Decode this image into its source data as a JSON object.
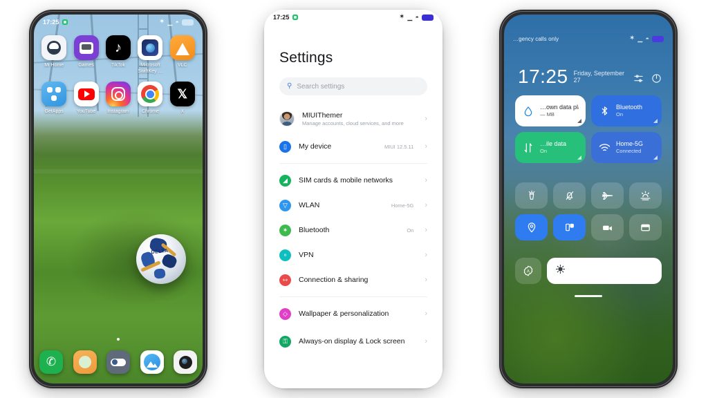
{
  "phone_home": {
    "status_bar": {
      "time": "17:25",
      "icons": [
        "green-shield-icon",
        "bluetooth-icon",
        "signal-icon",
        "wifi-icon",
        "battery-icon"
      ]
    },
    "apps": [
      {
        "label": "Mi Home",
        "icon": "mi-home-icon"
      },
      {
        "label": "Games",
        "icon": "games-icon"
      },
      {
        "label": "TikTok",
        "icon": "tiktok-icon",
        "glyph": "♪"
      },
      {
        "label": "Microsoft SwiftKey …",
        "icon": "microsoft-swiftkey-icon"
      },
      {
        "label": "VLC",
        "icon": "vlc-icon"
      },
      {
        "label": "GetApps",
        "icon": "getapps-icon"
      },
      {
        "label": "YouTube",
        "icon": "youtube-icon"
      },
      {
        "label": "Instagram",
        "icon": "instagram-icon"
      },
      {
        "label": "Chrome",
        "icon": "chrome-icon"
      },
      {
        "label": "X",
        "icon": "x-icon",
        "glyph": "𝕏"
      }
    ],
    "ball_brand": "DELTA",
    "dock": [
      {
        "name": "phone-app-icon",
        "glyph": "✆"
      },
      {
        "name": "messages-app-icon",
        "glyph": ""
      },
      {
        "name": "settings-app-icon",
        "glyph": ""
      },
      {
        "name": "gallery-app-icon",
        "glyph": ""
      },
      {
        "name": "camera-app-icon",
        "glyph": ""
      }
    ],
    "page_indicator_count": 1
  },
  "phone_settings": {
    "status_bar": {
      "time": "17:25"
    },
    "title": "Settings",
    "search": {
      "placeholder": "Search settings",
      "icon": "search-icon"
    },
    "account": {
      "name": "MIUIThemer",
      "subtitle": "Manage accounts, cloud services, and more",
      "avatar": "user-avatar"
    },
    "rows": [
      {
        "label": "My device",
        "value": "MIUI 12.5.11",
        "icon": "device-icon",
        "color": "bg-blue"
      },
      {
        "label": "SIM cards & mobile networks",
        "value": "",
        "icon": "sim-card-icon",
        "color": "bg-green"
      },
      {
        "label": "WLAN",
        "value": "Home-5G",
        "icon": "wlan-icon",
        "color": "bg-ltblue"
      },
      {
        "label": "Bluetooth",
        "value": "On",
        "icon": "bluetooth-icon",
        "color": "bg-grn2"
      },
      {
        "label": "VPN",
        "value": "",
        "icon": "vpn-key-icon",
        "color": "bg-teal"
      },
      {
        "label": "Connection & sharing",
        "value": "",
        "icon": "connection-icon",
        "color": "bg-red"
      },
      {
        "label": "Wallpaper & personalization",
        "value": "",
        "icon": "wallpaper-icon",
        "color": "bg-pink"
      },
      {
        "label": "Always-on display & Lock screen",
        "value": "",
        "icon": "lock-screen-icon",
        "color": "bg-green3"
      }
    ],
    "chevron": "›"
  },
  "phone_control": {
    "status_bar": {
      "carrier": "…gency calls only"
    },
    "clock": {
      "time": "17:25",
      "date": "Friday, September 27"
    },
    "header_icons": [
      "sliders-icon",
      "power-icon"
    ],
    "big_tiles": [
      {
        "title": "…own data plan",
        "sub": "— MB",
        "icon": "data-plan-icon",
        "style": "tile-white"
      },
      {
        "title": "Bluetooth",
        "sub": "On",
        "icon": "bluetooth-icon",
        "style": "tile-blue"
      },
      {
        "title": "…ile data",
        "sub": "On",
        "icon": "mobile-data-icon",
        "style": "tile-green"
      },
      {
        "title": "Home-5G",
        "sub": "Connected",
        "icon": "wifi-icon",
        "style": "tile-blue2"
      }
    ],
    "toggles": [
      {
        "name": "flashlight-icon",
        "state": "off"
      },
      {
        "name": "silent-mode-icon",
        "state": "off"
      },
      {
        "name": "airplane-mode-icon",
        "state": "off"
      },
      {
        "name": "reading-mode-icon",
        "state": "off"
      },
      {
        "name": "location-icon",
        "state": "on"
      },
      {
        "name": "screenshot-icon",
        "state": "on"
      },
      {
        "name": "screen-recorder-icon",
        "state": "off"
      },
      {
        "name": "dark-mode-icon",
        "state": "off"
      }
    ],
    "auto_brightness": {
      "label": "A",
      "name": "auto-brightness-icon"
    },
    "brightness_slider": {
      "icon": "brightness-icon",
      "value": 100
    }
  }
}
